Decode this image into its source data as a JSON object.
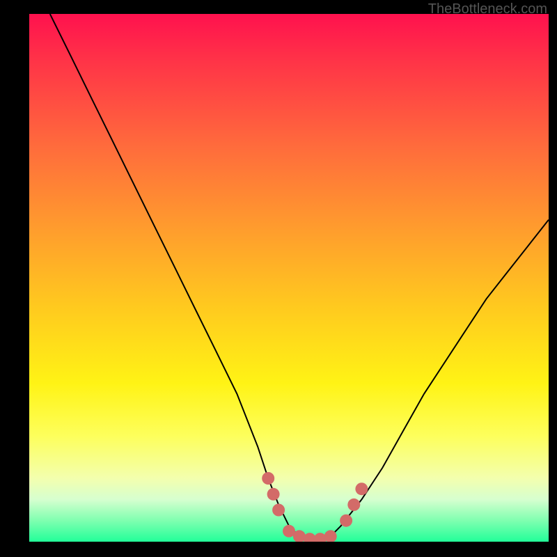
{
  "watermark": "TheBottleneck.com",
  "colors": {
    "marker": "#d36b68",
    "line": "#000000"
  },
  "chart_data": {
    "type": "line",
    "title": "",
    "xlabel": "",
    "ylabel": "",
    "xlim": [
      0,
      100
    ],
    "ylim": [
      0,
      100
    ],
    "series": [
      {
        "name": "curve",
        "x": [
          4,
          8,
          12,
          16,
          20,
          24,
          28,
          32,
          36,
          40,
          44,
          46,
          48,
          50,
          52,
          54,
          56,
          58,
          60,
          64,
          68,
          72,
          76,
          80,
          84,
          88,
          92,
          96,
          100
        ],
        "y": [
          100,
          92,
          84,
          76,
          68,
          60,
          52,
          44,
          36,
          28,
          18,
          12,
          7,
          3,
          1,
          0.5,
          0.5,
          1,
          3,
          8,
          14,
          21,
          28,
          34,
          40,
          46,
          51,
          56,
          61
        ]
      }
    ],
    "markers": [
      {
        "x": 46,
        "y": 12
      },
      {
        "x": 47,
        "y": 9
      },
      {
        "x": 48,
        "y": 6
      },
      {
        "x": 50,
        "y": 2
      },
      {
        "x": 52,
        "y": 1
      },
      {
        "x": 54,
        "y": 0.5
      },
      {
        "x": 56,
        "y": 0.5
      },
      {
        "x": 58,
        "y": 1
      },
      {
        "x": 61,
        "y": 4
      },
      {
        "x": 62.5,
        "y": 7
      },
      {
        "x": 64,
        "y": 10
      }
    ]
  }
}
